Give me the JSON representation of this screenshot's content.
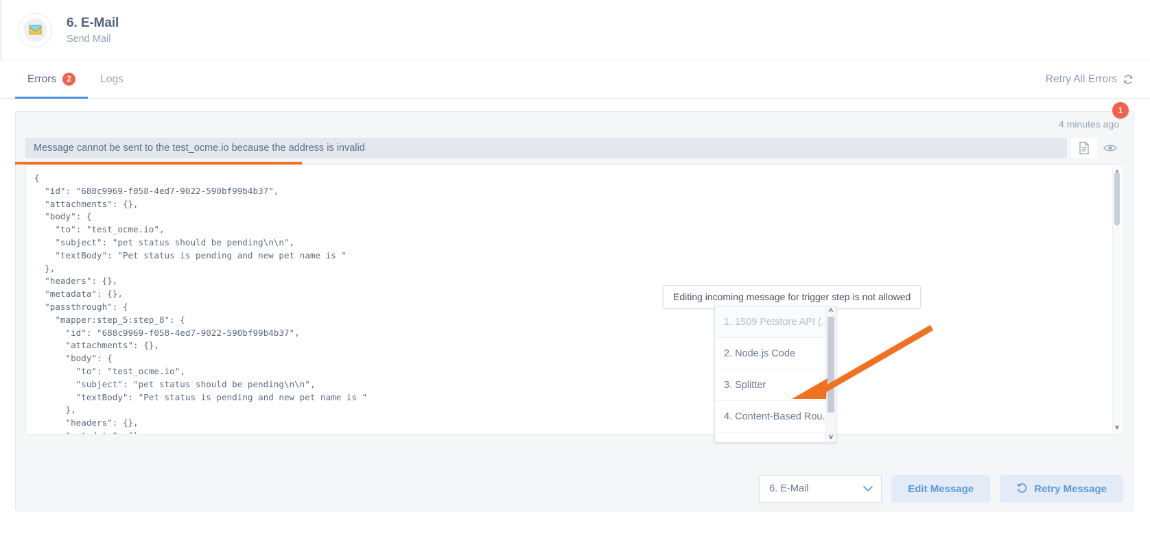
{
  "header": {
    "title": "6. E-Mail",
    "subtitle": "Send Mail",
    "avatar_icon": "envelope-mail-icon"
  },
  "tabs": [
    {
      "label": "Errors",
      "badge": "2",
      "active": true
    },
    {
      "label": "Logs",
      "badge": "",
      "active": false
    }
  ],
  "retry_all": {
    "label": "Retry All Errors",
    "icon": "refresh-icon"
  },
  "error_card": {
    "corner_badge": "1",
    "timestamp": "4 minutes ago",
    "message": "Message cannot be sent to the test_ocme.io because the address is invalid",
    "icons": [
      {
        "name": "document-icon",
        "selected": true
      },
      {
        "name": "eye-icon",
        "selected": false
      }
    ],
    "payload": "{\n  \"id\": \"688c9969-f058-4ed7-9022-590bf99b4b37\",\n  \"attachments\": {},\n  \"body\": {\n    \"to\": \"test_ocme.io\",\n    \"subject\": \"pet status should be pending\\n\\n\",\n    \"textBody\": \"Pet status is pending and new pet name is \"\n  },\n  \"headers\": {},\n  \"metadata\": {},\n  \"passthrough\": {\n    \"mapper:step_5:step_8\": {\n      \"id\": \"688c9969-f058-4ed7-9022-590bf99b4b37\",\n      \"attachments\": {},\n      \"body\": {\n        \"to\": \"test_ocme.io\",\n        \"subject\": \"pet status should be pending\\n\\n\",\n        \"textBody\": \"Pet status is pending and new pet name is \"\n      },\n      \"headers\": {},\n      \"metadata\": {}"
  },
  "tooltip": {
    "text": "Editing incoming message for trigger step is not allowed"
  },
  "step_dropdown": {
    "selected": "6. E-Mail",
    "options": [
      {
        "label": "1. 1509 Petstore API (...",
        "disabled": true
      },
      {
        "label": "2. Node.js Code",
        "disabled": false
      },
      {
        "label": "3. Splitter",
        "disabled": false
      },
      {
        "label": "4. Content-Based Rou...",
        "disabled": false
      }
    ]
  },
  "actions": {
    "edit_message": "Edit Message",
    "retry_message": "Retry Message",
    "retry_icon": "undo-refresh-icon"
  },
  "colors": {
    "accent_blue": "#5b9bd5",
    "badge_red": "#f4614a",
    "annotation_orange": "#ef7222",
    "text_muted": "#93a2b6"
  }
}
